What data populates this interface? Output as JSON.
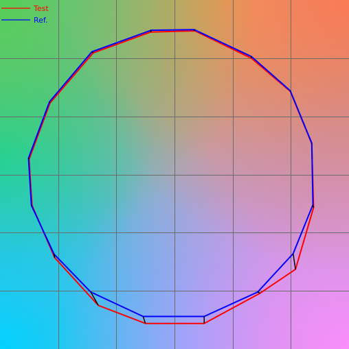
{
  "chart_data": {
    "type": "line",
    "title": "",
    "xlabel": "",
    "ylabel": "",
    "xlim": [
      0,
      6
    ],
    "ylim": [
      0,
      6
    ],
    "grid": true,
    "legend_position": "top-left",
    "background": "color-gradient",
    "series": [
      {
        "name": "Test",
        "color": "#ff0000",
        "closed": true,
        "x": [
          2.59,
          3.35,
          4.32,
          4.99,
          5.36,
          5.39,
          5.08,
          4.47,
          3.51,
          2.5,
          1.69,
          0.94,
          0.55,
          0.5,
          0.86,
          1.6
        ],
        "y": [
          5.45,
          5.47,
          5.0,
          4.43,
          3.53,
          2.43,
          1.37,
          0.96,
          0.44,
          0.44,
          0.75,
          1.57,
          2.47,
          3.26,
          4.23,
          5.09
        ]
      },
      {
        "name": "Ref.",
        "color": "#0000ff",
        "closed": true,
        "x": [
          2.6,
          3.34,
          4.32,
          4.99,
          5.36,
          5.38,
          5.04,
          4.43,
          3.51,
          2.46,
          1.56,
          0.93,
          0.54,
          0.49,
          0.85,
          1.58
        ],
        "y": [
          5.48,
          5.49,
          5.03,
          4.44,
          3.54,
          2.48,
          1.64,
          0.98,
          0.56,
          0.56,
          0.98,
          1.63,
          2.47,
          3.28,
          4.25,
          5.11
        ]
      }
    ]
  }
}
